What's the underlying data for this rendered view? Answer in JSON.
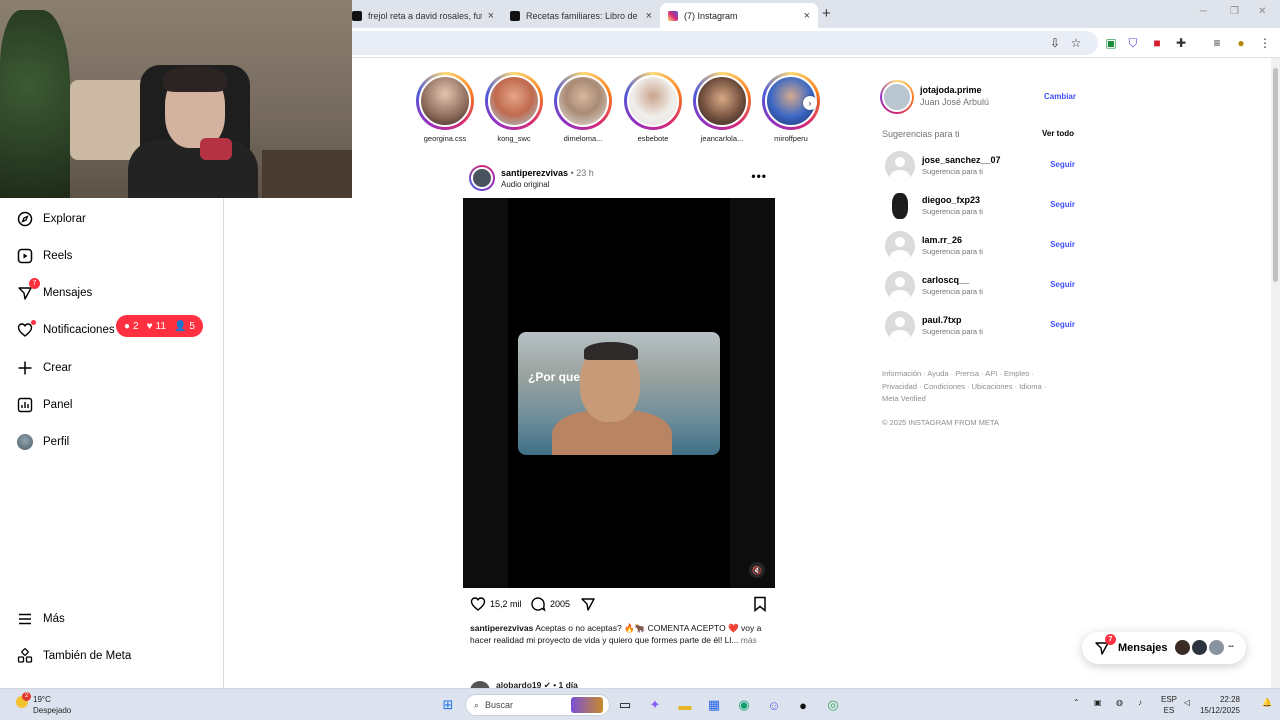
{
  "browser": {
    "tabs": [
      {
        "title": "frejol reta a david rosales, futb",
        "active": false
      },
      {
        "title": "Recetas familiares: Libro de coc",
        "active": false
      },
      {
        "title": "(7) Instagram",
        "active": true
      }
    ],
    "new_tab": "+",
    "close_glyph": "×"
  },
  "nav": {
    "items": [
      {
        "label": "Explorar",
        "icon": "compass-icon"
      },
      {
        "label": "Reels",
        "icon": "reels-icon"
      },
      {
        "label": "Mensajes",
        "icon": "messenger-icon",
        "badge": "7"
      },
      {
        "label": "Notificaciones",
        "icon": "heart-icon"
      },
      {
        "label": "Crear",
        "icon": "plus-icon"
      },
      {
        "label": "Panel",
        "icon": "chart-icon"
      },
      {
        "label": "Perfil",
        "icon": "profile-icon"
      },
      {
        "label": "Más",
        "icon": "menu-icon"
      },
      {
        "label": "También de Meta",
        "icon": "meta-icon"
      }
    ],
    "notifications_pill": {
      "comments": "2",
      "likes": "11",
      "follows": "5"
    }
  },
  "stories": [
    {
      "name": "georgina.css"
    },
    {
      "name": "kong_swc"
    },
    {
      "name": "dimeloma..."
    },
    {
      "name": "esbebote"
    },
    {
      "name": "jeancarlola..."
    },
    {
      "name": "miroffperu"
    }
  ],
  "post": {
    "username": "santiperezvivas",
    "time": "• 23 h",
    "audio": "Audio original",
    "more": "•••",
    "clip_text": "¿Por que",
    "likes": "15,2 mil",
    "comments": "2005",
    "caption_user": "santiperezvivas",
    "caption_text": " Aceptas o no aceptas? 🔥🐂 COMENTA ACEPTO ❤️ voy a hacer realidad mi proyecto de vida y quiero que formes parte de él! Ll...",
    "caption_more": " más",
    "next_user": "alobardo19 ✔ • 1 día"
  },
  "sidebar": {
    "me_username": "jotajoda.prime",
    "me_fullname": "Juan José Arbulú",
    "switch_label": "Cambiar",
    "suggestions_title": "Sugerencias para ti",
    "see_all": "Ver todo",
    "suggestions": [
      {
        "username": "jose_sanchez__07",
        "sub": "Sugerencia para ti",
        "action": "Seguir"
      },
      {
        "username": "diegoo_fxp23",
        "sub": "Sugerencia para ti",
        "action": "Seguir"
      },
      {
        "username": "lam.rr_26",
        "sub": "Sugerencia para ti",
        "action": "Seguir"
      },
      {
        "username": "carloscq__",
        "sub": "Sugerencia para ti",
        "action": "Seguir"
      },
      {
        "username": "paul.7txp",
        "sub": "Sugerencia para ti",
        "action": "Seguir"
      }
    ],
    "footer_links": "Información · Ayuda · Prensa · API · Empleo · Privacidad · Condiciones · Ubicaciones · Idioma · Meta Verified",
    "copyright": "© 2025 INSTAGRAM FROM META"
  },
  "messages_button": {
    "label": "Mensajes",
    "badge": "7"
  },
  "taskbar": {
    "weather_temp": "19°C",
    "weather_desc": "Despejado",
    "weather_badge": "2",
    "search_placeholder": "Buscar",
    "lang_1": "ESP",
    "lang_2": "ES",
    "time": "22:28",
    "date": "15/12/2025"
  },
  "colors": {
    "accent": "#4150f7",
    "badge": "#ff3040"
  }
}
